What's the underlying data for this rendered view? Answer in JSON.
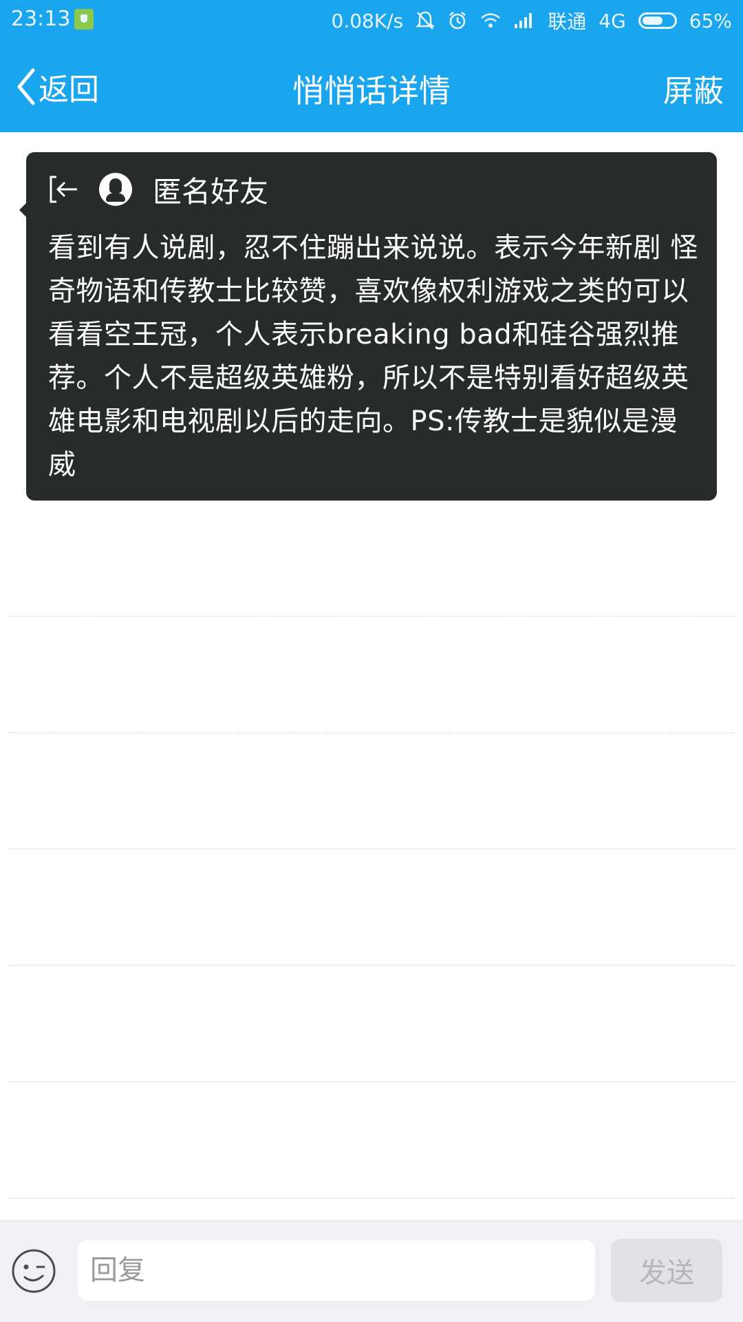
{
  "status_bar": {
    "time": "23:13",
    "net_speed": "0.08K/s",
    "carrier": "联通",
    "network": "4G",
    "battery": "65%",
    "battery_level": 0.65,
    "icons": [
      "shield-icon",
      "mute-bell-icon",
      "alarm-icon",
      "wifi-icon",
      "signal-icon",
      "battery-icon"
    ]
  },
  "title_bar": {
    "back_label": "返回",
    "title": "悄悄话详情",
    "action_label": "屏蔽",
    "background": "#1aa6ee"
  },
  "message": {
    "sender": "匿名好友",
    "text": "看到有人说剧，忍不住蹦出来说说。表示今年新剧 怪奇物语和传教士比较赞，喜欢像权利游戏之类的可以看看空王冠，个人表示breaking bad和硅谷强烈推荐。个人不是超级英雄粉，所以不是特别看好超级英雄电影和电视剧以后的走向。PS:传教士是貌似是漫威",
    "card_color": "#272b2c",
    "icons": [
      "exit-icon",
      "anonymous-avatar-icon"
    ]
  },
  "reply_bar": {
    "placeholder": "回复",
    "value": "",
    "send_label": "发送",
    "icons": [
      "emoji-icon"
    ]
  }
}
